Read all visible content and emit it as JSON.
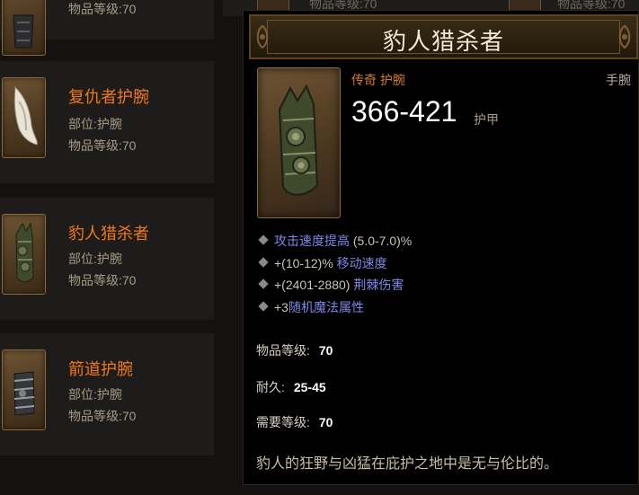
{
  "list": {
    "items": [
      {
        "title": "",
        "slot": "",
        "level": "物品等级:70"
      },
      {
        "title": "复仇者护腕",
        "slot": "部位:护腕",
        "level": "物品等级:70"
      },
      {
        "title": "豹人猎杀者",
        "slot": "部位:护腕",
        "level": "物品等级:70"
      },
      {
        "title": "箭道护腕",
        "slot": "部位:护腕",
        "level": "物品等级:70"
      }
    ]
  },
  "top_strip": {
    "level_a": "物品等级:70",
    "level_b": "物品等级:70"
  },
  "tooltip": {
    "title": "豹人猎杀者",
    "rarity": "传奇 护腕",
    "slot": "手腕",
    "armor_value": "366-421",
    "armor_label": "护甲",
    "affixes": [
      {
        "white": "",
        "blue": "攻击速度提高",
        "tail": " (5.0-7.0)%"
      },
      {
        "white": "+(10-12)% ",
        "blue": "移动速度",
        "tail": ""
      },
      {
        "white": "+(2401-2880) ",
        "blue": "荆棘伤害",
        "tail": ""
      },
      {
        "white": "+3",
        "blue": "随机魔法属性",
        "tail": ""
      }
    ],
    "stats": {
      "item_level_label": "物品等级:",
      "item_level_value": "70",
      "durability_label": "耐久:",
      "durability_value": "25-45",
      "required_level_label": "需要等级:",
      "required_level_value": "70"
    },
    "flavor": "豹人的狂野与凶猛在庇护之地中是无与伦比的。"
  },
  "colors": {
    "legendary_orange": "#f0771e",
    "magic_blue": "#7f86e6",
    "frame_gold": "#8a6a36"
  }
}
